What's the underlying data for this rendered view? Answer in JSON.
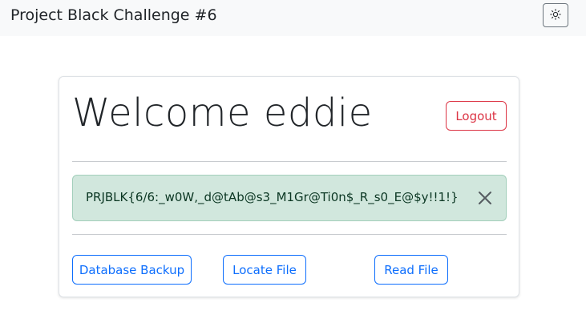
{
  "navbar": {
    "title": "Project Black Challenge #6",
    "theme_toggle_icon": "sun-icon"
  },
  "card": {
    "welcome_text": "Welcome eddie",
    "logout_label": "Logout",
    "alert": {
      "message": "PRJBLK{6/6:_w0W,_d@tAb@s3_M1Gr@Ti0n$_R_s0_E@$y!!1!}",
      "close_icon": "close-icon"
    },
    "actions": [
      {
        "label": "Database Backup"
      },
      {
        "label": "Locate File"
      },
      {
        "label": "Read File"
      }
    ]
  },
  "colors": {
    "primary": "#0d6efd",
    "danger": "#dc3545",
    "success_bg": "#d1e7dd",
    "navbar_bg": "#f8f9fa"
  }
}
